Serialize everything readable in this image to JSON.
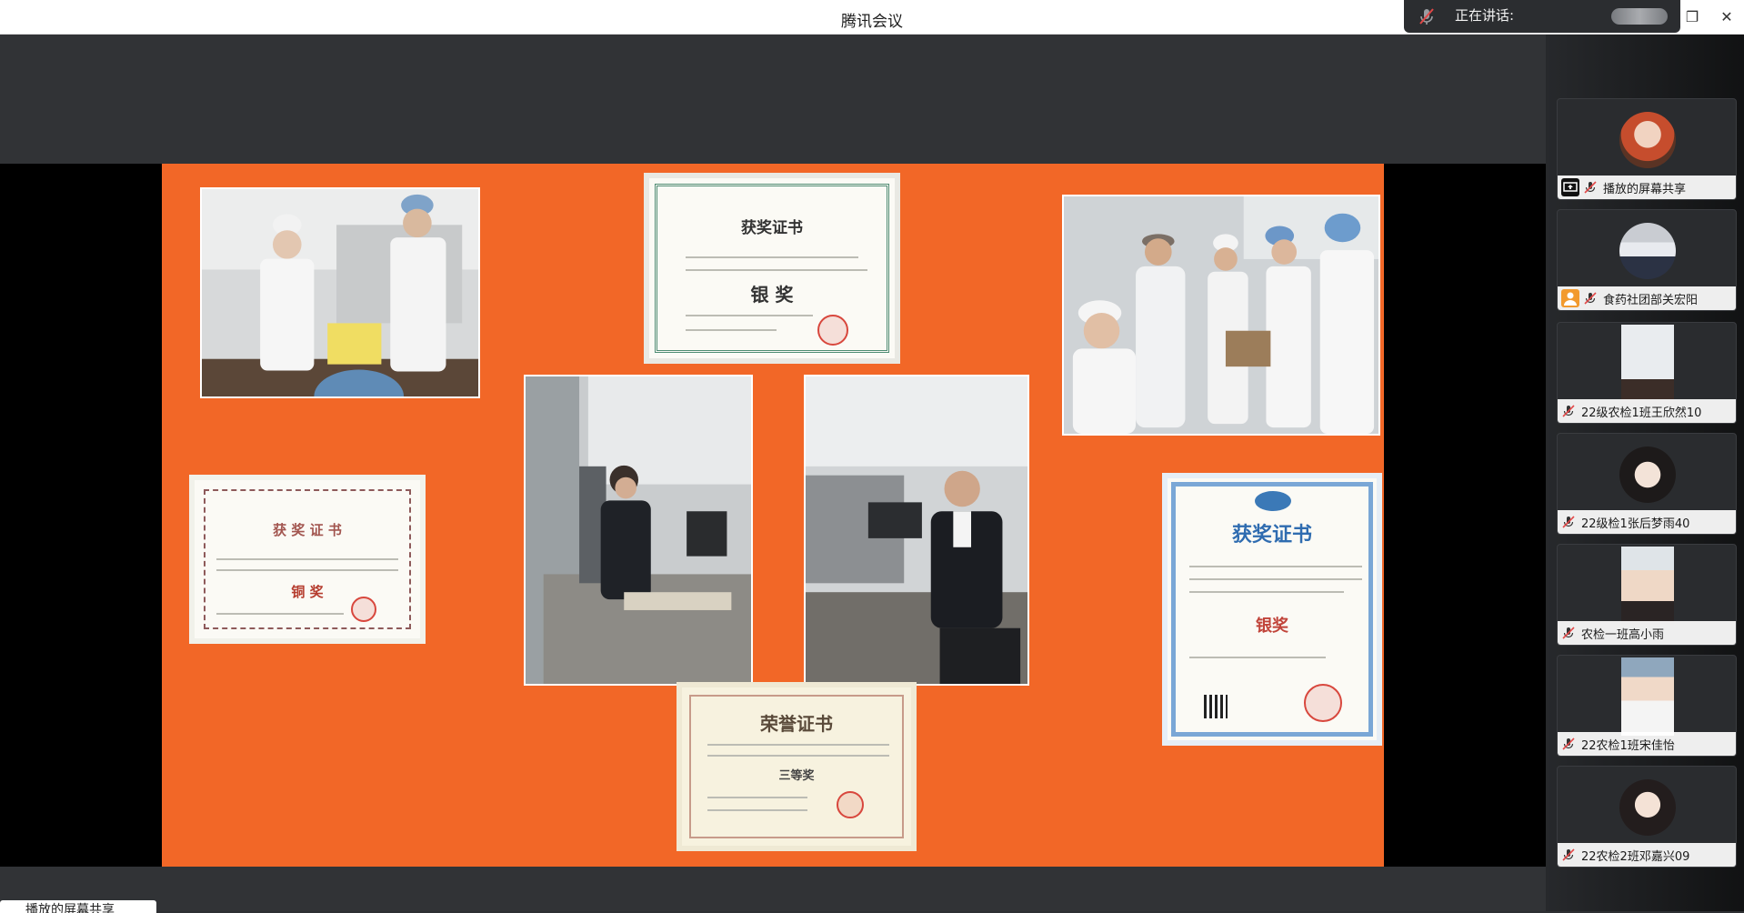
{
  "window": {
    "title": "腾讯会议",
    "speaking_label": "正在讲话:",
    "restore_icon": "restore-window-icon",
    "close_icon": "close-icon",
    "collapse_icon": "chevron-right-icon"
  },
  "slide": {
    "background": "#f26727",
    "certificates": [
      {
        "heading": "获奖证书",
        "award": "银 奖"
      },
      {
        "heading": "获 奖 证 书",
        "award": "铜 奖"
      },
      {
        "heading": "获奖证书",
        "award": "银奖"
      },
      {
        "heading": "荣誉证书",
        "award": "三等奖"
      }
    ]
  },
  "participants": [
    {
      "name": "播放的屏幕共享",
      "icon": "screen-share-icon"
    },
    {
      "name": "食药社团部关宏阳",
      "icon": "user-badge-icon"
    },
    {
      "name": "22级农检1班王欣然10"
    },
    {
      "name": "22级检1张后梦雨40"
    },
    {
      "name": "农检一班高小雨"
    },
    {
      "name": "22农检1班宋佳怡"
    },
    {
      "name": "22农检2班邓嘉兴09"
    }
  ],
  "bottom_chip": "播放的屏幕共享"
}
